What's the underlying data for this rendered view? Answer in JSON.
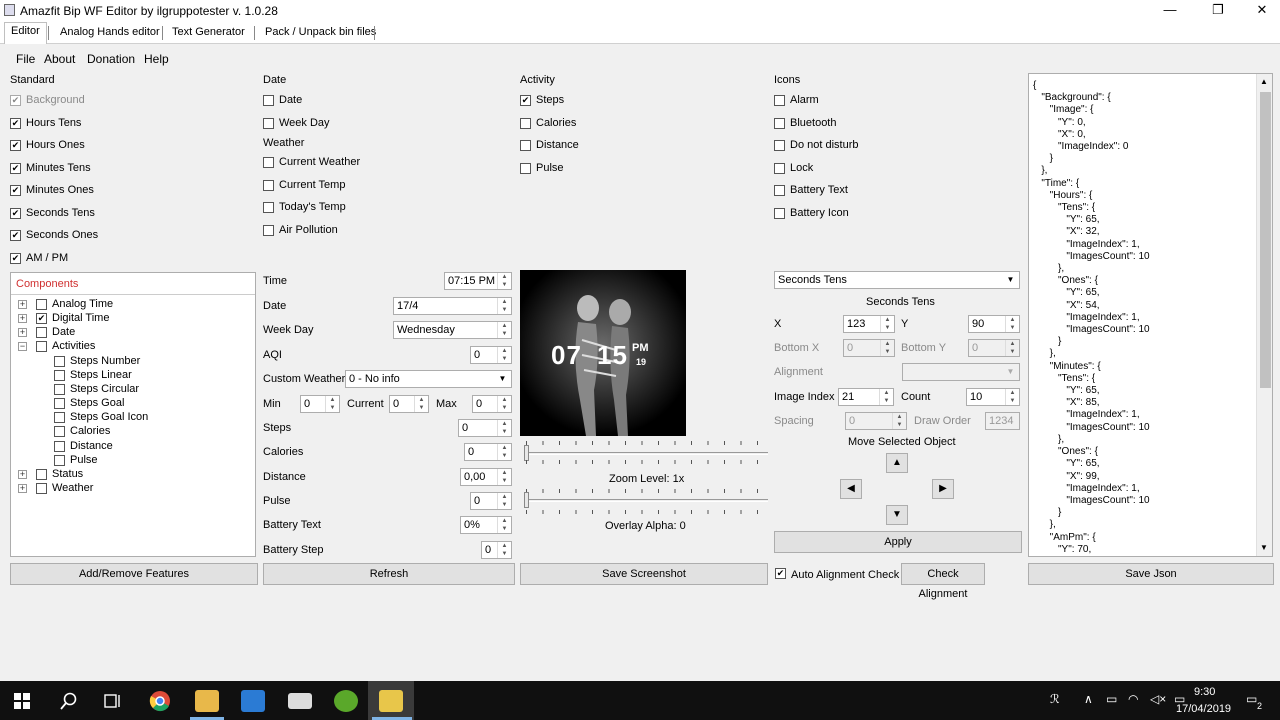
{
  "window": {
    "title": "Amazfit Bip WF Editor by ilgruppotester v. 1.0.28",
    "minimize": "—",
    "maximize": "❐",
    "close": "✕"
  },
  "tabs": [
    "Editor",
    "Analog Hands editor",
    "Text Generator",
    "Pack / Unpack bin files"
  ],
  "menu": [
    "File",
    "About",
    "Donation",
    "Help"
  ],
  "standard": {
    "heading": "Standard",
    "items": [
      {
        "label": "Background",
        "checked": true,
        "disabled": true
      },
      {
        "label": "Hours Tens",
        "checked": true
      },
      {
        "label": "Hours Ones",
        "checked": true
      },
      {
        "label": "Minutes Tens",
        "checked": true
      },
      {
        "label": "Minutes Ones",
        "checked": true
      },
      {
        "label": "Seconds Tens",
        "checked": true
      },
      {
        "label": "Seconds Ones",
        "checked": true
      },
      {
        "label": "AM / PM",
        "checked": true
      }
    ]
  },
  "date_section": {
    "heading": "Date",
    "items": [
      {
        "label": "Date",
        "checked": false
      },
      {
        "label": "Week Day",
        "checked": false
      }
    ]
  },
  "weather_section": {
    "heading": "Weather",
    "items": [
      {
        "label": "Current Weather",
        "checked": false
      },
      {
        "label": "Current Temp",
        "checked": false
      },
      {
        "label": "Today's Temp",
        "checked": false
      },
      {
        "label": "Air Pollution",
        "checked": false
      }
    ]
  },
  "activity_section": {
    "heading": "Activity",
    "items": [
      {
        "label": "Steps",
        "checked": true
      },
      {
        "label": "Calories",
        "checked": false
      },
      {
        "label": "Distance",
        "checked": false
      },
      {
        "label": "Pulse",
        "checked": false
      }
    ]
  },
  "icons_section": {
    "heading": "Icons",
    "items": [
      {
        "label": "Alarm",
        "checked": false
      },
      {
        "label": "Bluetooth",
        "checked": false
      },
      {
        "label": "Do not disturb",
        "checked": false
      },
      {
        "label": "Lock",
        "checked": false
      },
      {
        "label": "Battery Text",
        "checked": false
      },
      {
        "label": "Battery Icon",
        "checked": false
      }
    ]
  },
  "components": {
    "heading": "Components",
    "tree": [
      {
        "label": "Analog Time",
        "checked": false,
        "level": 0,
        "expander": "+"
      },
      {
        "label": "Digital Time",
        "checked": true,
        "level": 0,
        "expander": "+"
      },
      {
        "label": "Date",
        "checked": false,
        "level": 0,
        "expander": "+"
      },
      {
        "label": "Activities",
        "checked": false,
        "level": 0,
        "expander": "−"
      },
      {
        "label": "Steps Number",
        "checked": false,
        "level": 1
      },
      {
        "label": "Steps Linear",
        "checked": false,
        "level": 1
      },
      {
        "label": "Steps Circular",
        "checked": false,
        "level": 1
      },
      {
        "label": "Steps Goal",
        "checked": false,
        "level": 1
      },
      {
        "label": "Steps Goal Icon",
        "checked": false,
        "level": 1
      },
      {
        "label": "Calories",
        "checked": false,
        "level": 1
      },
      {
        "label": "Distance",
        "checked": false,
        "level": 1
      },
      {
        "label": "Pulse",
        "checked": false,
        "level": 1
      },
      {
        "label": "Status",
        "checked": false,
        "level": 0,
        "expander": "+"
      },
      {
        "label": "Weather",
        "checked": false,
        "level": 0,
        "expander": "+"
      }
    ]
  },
  "preview_fields": {
    "time_label": "Time",
    "time_value": "07:15 PM",
    "date_label": "Date",
    "date_value": "17/4",
    "weekday_label": "Week Day",
    "weekday_value": "Wednesday",
    "aqi_label": "AQI",
    "aqi_value": "0",
    "custom_weather_label": "Custom Weather",
    "custom_weather_value": "0 - No info",
    "min_label": "Min",
    "min_value": "0",
    "current_label": "Current",
    "current_value": "0",
    "max_label": "Max",
    "max_value": "0",
    "steps_label": "Steps",
    "steps_value": "0",
    "calories_label": "Calories",
    "calories_value": "0",
    "distance_label": "Distance",
    "distance_value": "0,00",
    "pulse_label": "Pulse",
    "pulse_value": "0",
    "battery_text_label": "Battery Text",
    "battery_text_value": "0%",
    "battery_step_label": "Battery Step",
    "battery_step_value": "0"
  },
  "preview": {
    "clock_hours": "07",
    "clock_minutes": "15",
    "clock_ampm": "PM",
    "clock_seconds": "19",
    "zoom_label": "Zoom Level: 1x",
    "overlay_label": "Overlay Alpha: 0",
    "zoom_fraction": 0.0,
    "overlay_fraction": 0.0
  },
  "properties": {
    "selected_object": "Seconds Tens",
    "group_title": "Seconds Tens",
    "x_label": "X",
    "x_value": "123",
    "y_label": "Y",
    "y_value": "90",
    "bottom_x_label": "Bottom X",
    "bottom_x_value": "0",
    "bottom_y_label": "Bottom Y",
    "bottom_y_value": "0",
    "alignment_label": "Alignment",
    "alignment_value": "",
    "image_index_label": "Image Index",
    "image_index_value": "21",
    "count_label": "Count",
    "count_value": "10",
    "spacing_label": "Spacing",
    "spacing_value": "0",
    "draw_order_label": "Draw Order",
    "draw_order_value": "1234",
    "move_label": "Move Selected Object",
    "apply_label": "Apply"
  },
  "json_text": "{\n   \"Background\": {\n      \"Image\": {\n         \"Y\": 0,\n         \"X\": 0,\n         \"ImageIndex\": 0\n      }\n   },\n   \"Time\": {\n      \"Hours\": {\n         \"Tens\": {\n            \"Y\": 65,\n            \"X\": 32,\n            \"ImageIndex\": 1,\n            \"ImagesCount\": 10\n         },\n         \"Ones\": {\n            \"Y\": 65,\n            \"X\": 54,\n            \"ImageIndex\": 1,\n            \"ImagesCount\": 10\n         }\n      },\n      \"Minutes\": {\n         \"Tens\": {\n            \"Y\": 65,\n            \"X\": 85,\n            \"ImageIndex\": 1,\n            \"ImagesCount\": 10\n         },\n         \"Ones\": {\n            \"Y\": 65,\n            \"X\": 99,\n            \"ImageIndex\": 1,\n            \"ImagesCount\": 10\n         }\n      },\n      \"AmPm\": {\n         \"Y\": 70,",
  "bottom_buttons": {
    "add_remove": "Add/Remove Features",
    "refresh": "Refresh",
    "save_screenshot": "Save Screenshot",
    "auto_alignment": "Auto Alignment Check",
    "check_alignment": "Check Alignment",
    "save_json": "Save Json"
  },
  "taskbar": {
    "time": "9:30",
    "date": "17/04/2019",
    "notification_count": "2"
  },
  "colors": {
    "components_heading": "#d03030",
    "taskbar": "#101010"
  }
}
